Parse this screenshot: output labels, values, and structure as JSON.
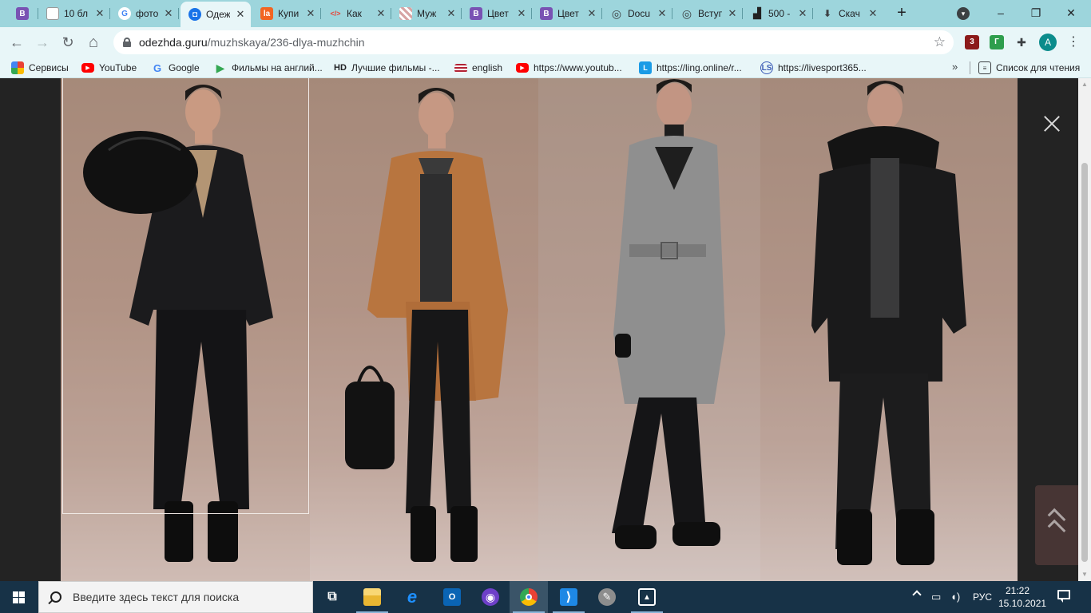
{
  "browser": {
    "tabs": [
      {
        "title": "",
        "favicon": "bootstrap-icon",
        "color": "#7952b3",
        "letter": "B"
      },
      {
        "title": "10 бл",
        "favicon": "page-icon",
        "color": "#ffffff",
        "letter": ""
      },
      {
        "title": "фото",
        "favicon": "google-icon",
        "color": "#4285f4",
        "letter": "G"
      },
      {
        "title": "Одеж",
        "favicon": "odezhda-icon",
        "color": "#1a73e8",
        "letter": "◘"
      },
      {
        "title": "Купи",
        "favicon": "la-icon",
        "color": "#f26522",
        "letter": "la"
      },
      {
        "title": "Как",
        "favicon": "code-icon",
        "color": "#e8f6f8",
        "letter": "</>"
      },
      {
        "title": "Муж",
        "favicon": "pattern-icon",
        "color": "#d7a4a4",
        "letter": ""
      },
      {
        "title": "Цвет",
        "favicon": "bootstrap-icon",
        "color": "#7952b3",
        "letter": "B"
      },
      {
        "title": "Цвет",
        "favicon": "bootstrap-icon",
        "color": "#7952b3",
        "letter": "B"
      },
      {
        "title": "Docu",
        "favicon": "globe-icon",
        "color": "#3c4043",
        "letter": "◎"
      },
      {
        "title": "Вступ",
        "favicon": "globe-icon",
        "color": "#3c4043",
        "letter": "◎"
      },
      {
        "title": "500 -",
        "favicon": "500px-icon",
        "color": "#222222",
        "letter": "▟"
      },
      {
        "title": "Скач",
        "favicon": "download-icon",
        "color": "#3c4043",
        "letter": "⬇"
      }
    ],
    "active_tab_index": 3,
    "new_tab": "+",
    "window": {
      "minimize": "–",
      "maximize": "❐",
      "close": "✕"
    }
  },
  "toolbar": {
    "back": "←",
    "forward": "→",
    "reload": "↻",
    "home": "⌂",
    "url_domain": "odezhda.guru",
    "url_path": "/muzhskaya/236-dlya-muzhchin",
    "star": "☆",
    "extensions": [
      {
        "name": "ublock-icon",
        "label": "3",
        "color": "#8b1a1a"
      },
      {
        "name": "grammarly-icon",
        "label": "Г",
        "color": "#2e9e4d"
      },
      {
        "name": "puzzle-icon",
        "label": "✚",
        "color": "#3c4043"
      }
    ],
    "profile_letter": "A",
    "menu": "⋮"
  },
  "bookmarks": {
    "items": [
      {
        "label": "Сервисы",
        "icon": "apps-icon",
        "color": "#e94235"
      },
      {
        "label": "YouTube",
        "icon": "youtube-icon",
        "color": "#ff0000"
      },
      {
        "label": "Google",
        "icon": "google-icon",
        "color": "#4285f4"
      },
      {
        "label": "Фильмы на англий...",
        "icon": "play-icon",
        "color": "#34a853"
      },
      {
        "label": "Лучшие фильмы -...",
        "icon": "hd-icon",
        "color": "#202124"
      },
      {
        "label": "english",
        "icon": "flag-icon",
        "color": "#b22234"
      },
      {
        "label": "https://www.youtub...",
        "icon": "youtube-icon",
        "color": "#ff0000"
      },
      {
        "label": "https://ling.online/r...",
        "icon": "ling-icon",
        "color": "#1a9be6"
      },
      {
        "label": "https://livesport365...",
        "icon": "ls-icon",
        "color": "#3b5bb5"
      }
    ],
    "more": "»",
    "reading_list": "Список для чтения"
  },
  "page": {
    "close": "✕"
  },
  "taskbar": {
    "search_placeholder": "Введите здесь текст для поиска",
    "apps": [
      {
        "name": "task-view-icon",
        "label": "⧉",
        "color": "#173247"
      },
      {
        "name": "file-explorer-icon",
        "label": "",
        "color": "#f4c542"
      },
      {
        "name": "internet-explorer-icon",
        "label": "e",
        "color": "#1e90ff"
      },
      {
        "name": "outlook-icon",
        "label": "O",
        "color": "#0a64b4"
      },
      {
        "name": "github-desktop-icon",
        "label": "◉",
        "color": "#6e40c9"
      },
      {
        "name": "chrome-icon",
        "label": "",
        "color": "#e94235"
      },
      {
        "name": "vscode-icon",
        "label": "⟩",
        "color": "#1e88e5"
      },
      {
        "name": "paint-icon",
        "label": "✎",
        "color": "#8d8d8d"
      },
      {
        "name": "photos-icon",
        "label": "▲",
        "color": "#1a1a1a"
      }
    ],
    "tray_lang": "РУС",
    "time": "21:22",
    "date": "15.10.2021"
  }
}
